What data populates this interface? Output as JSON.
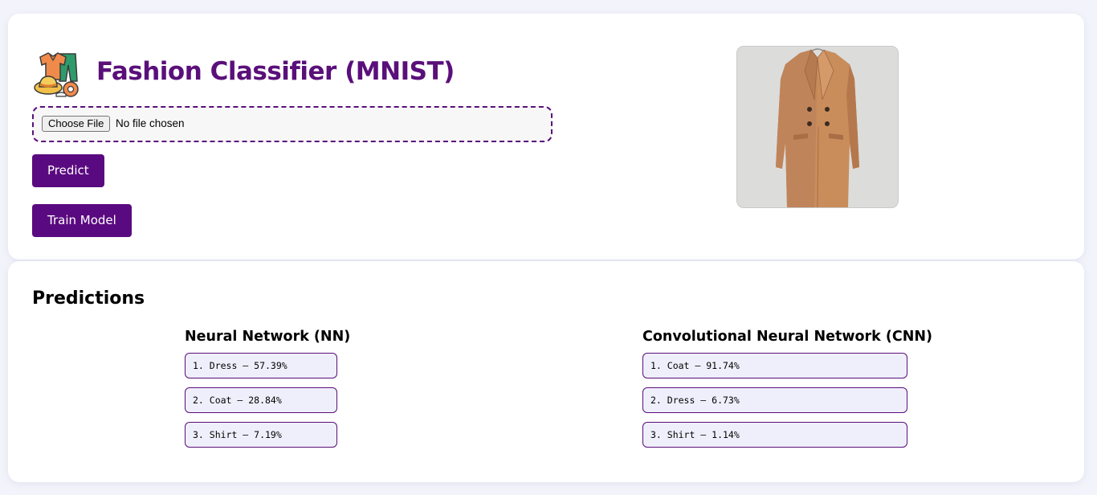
{
  "header": {
    "logo_icon": "clothes-icon",
    "title": "Fashion Classifier (MNIST)"
  },
  "upload": {
    "button_label": "Choose File",
    "status_text": "No file chosen"
  },
  "actions": {
    "predict_label": "Predict",
    "train_label": "Train Model"
  },
  "preview": {
    "image_subject": "camel coat",
    "icon": "coat-image"
  },
  "predictions": {
    "title": "Predictions",
    "nn": {
      "name": "Neural Network (NN)",
      "results": [
        "1. Dress — 57.39%",
        "2. Coat — 28.84%",
        "3. Shirt — 7.19%"
      ]
    },
    "cnn": {
      "name": "Convolutional Neural Network (CNN)",
      "results": [
        "1. Coat — 91.74%",
        "2. Dress — 6.73%",
        "3. Shirt — 1.14%"
      ]
    }
  },
  "colors": {
    "accent": "#5a0a80",
    "title": "#5a0f7a",
    "page_background": "#f3f4fb",
    "result_background": "#efeffb"
  }
}
